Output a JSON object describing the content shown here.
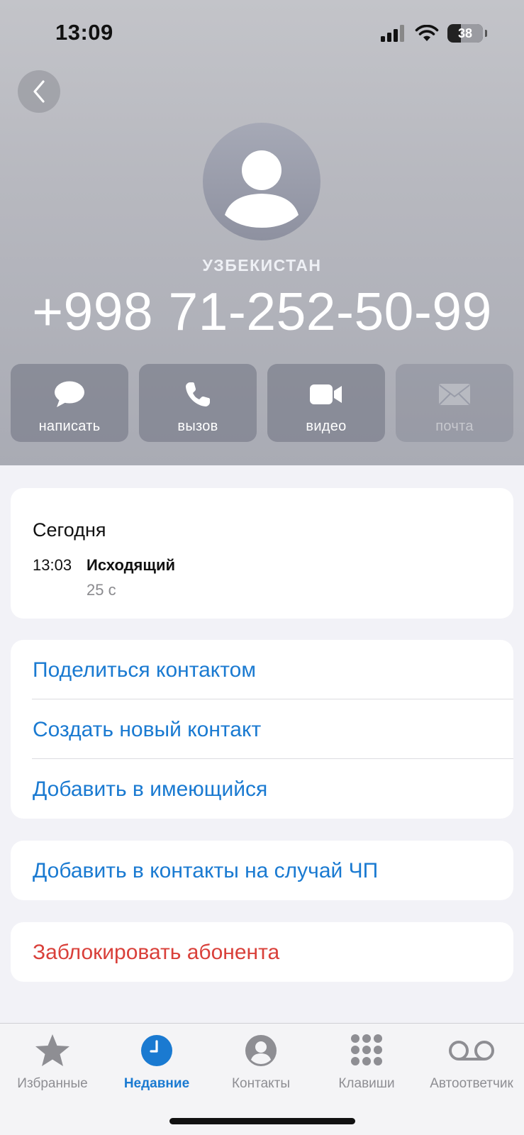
{
  "status": {
    "time": "13:09",
    "battery": "38"
  },
  "contact": {
    "country": "УЗБЕКИСТАН",
    "phone": "+998 71-252-50-99"
  },
  "actions": [
    {
      "label": "написать",
      "icon": "message-icon"
    },
    {
      "label": "вызов",
      "icon": "phone-icon"
    },
    {
      "label": "видео",
      "icon": "video-icon"
    },
    {
      "label": "почта",
      "icon": "mail-icon",
      "disabled": true
    }
  ],
  "recent": {
    "day": "Сегодня",
    "time": "13:03",
    "type": "Исходящий",
    "duration": "25 с"
  },
  "options": {
    "share": "Поделиться контактом",
    "create": "Создать новый контакт",
    "add_existing": "Добавить в имеющийся",
    "emergency": "Добавить в контакты на случай ЧП",
    "block": "Заблокировать абонента"
  },
  "tabs": [
    {
      "label": "Избранные",
      "icon": "star-icon"
    },
    {
      "label": "Недавние",
      "icon": "clock-icon",
      "active": true
    },
    {
      "label": "Контакты",
      "icon": "person-circle-icon"
    },
    {
      "label": "Клавиши",
      "icon": "keypad-icon"
    },
    {
      "label": "Автоответчик",
      "icon": "voicemail-icon"
    }
  ],
  "colors": {
    "accent": "#1a7ad1",
    "destructive": "#d9403a"
  }
}
